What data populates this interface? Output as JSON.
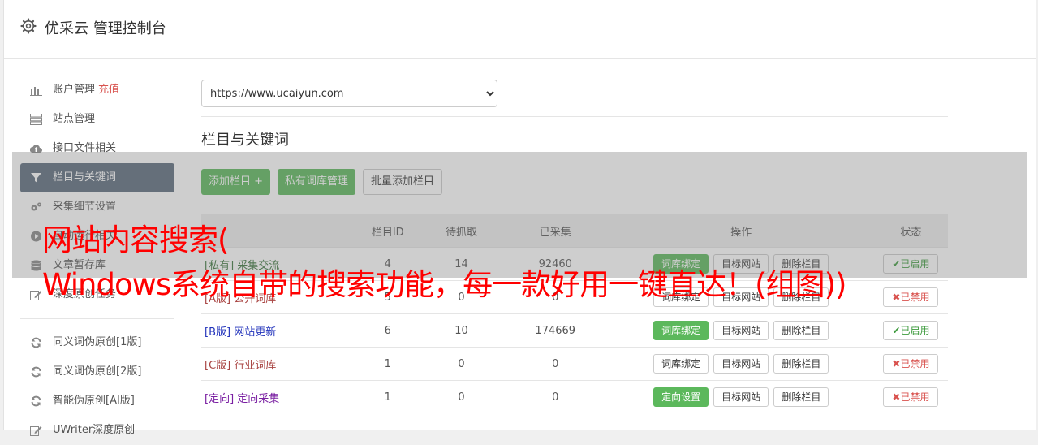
{
  "header": {
    "title": "优采云 管理控制台",
    "icon": "gear-icon"
  },
  "sidebar": {
    "items": [
      {
        "label": "账户管理",
        "extra": "充值",
        "icon": "bar-chart-icon"
      },
      {
        "label": "站点管理",
        "icon": "server-icon"
      },
      {
        "label": "接口文件相关",
        "icon": "cloud-upload-icon"
      },
      {
        "label": "栏目与关键词",
        "icon": "filter-icon",
        "active": true
      },
      {
        "label": "采集细节设置",
        "icon": "cogs-icon"
      },
      {
        "label": "自动运行相关",
        "icon": "play-circle-icon"
      },
      {
        "label": "文章暂存库",
        "icon": "database-icon"
      },
      {
        "label": "深度原创任务",
        "icon": "edit-icon"
      }
    ],
    "items2": [
      {
        "label": "同义词伪原创[1版]",
        "icon": "refresh-icon"
      },
      {
        "label": "同义词伪原创[2版]",
        "icon": "refresh-icon"
      },
      {
        "label": "智能伪原创[AI版]",
        "icon": "refresh-icon"
      },
      {
        "label": "UWriter深度原创",
        "icon": "edit-icon"
      }
    ]
  },
  "main": {
    "site_select": "https://www.ucaiyun.com",
    "section_title": "栏目与关键词",
    "buttons": {
      "add": "添加栏目 +",
      "private_lib": "私有词库管理",
      "batch_add": "批量添加栏目"
    },
    "table": {
      "headers": [
        "",
        "栏目ID",
        "待抓取",
        "已采集",
        "操作",
        "状态"
      ],
      "rows": [
        {
          "tag": "[私有]",
          "name": "采集交流",
          "id": "4",
          "pending": "14",
          "collected": "92460",
          "op1": "词库绑定",
          "op2": "目标网站",
          "op3": "删除栏目",
          "status": "已启用",
          "tag_class": "kw-green"
        },
        {
          "tag": "[A版]",
          "name": "公开词库",
          "id": "5",
          "pending": "0",
          "collected": "0",
          "op1": "词库绑定",
          "op2": "目标网站",
          "op3": "删除栏目",
          "status": "已禁用",
          "tag_class": "kw-red"
        },
        {
          "tag": "[B版]",
          "name": "网站更新",
          "id": "6",
          "pending": "10",
          "collected": "174669",
          "op1": "词库绑定",
          "op2": "目标网站",
          "op3": "删除栏目",
          "status": "已启用",
          "tag_class": "kw-blue"
        },
        {
          "tag": "[C版]",
          "name": "行业词库",
          "id": "1",
          "pending": "0",
          "collected": "0",
          "op1": "词库绑定",
          "op2": "目标网站",
          "op3": "删除栏目",
          "status": "已禁用",
          "tag_class": "kw-red"
        },
        {
          "tag": "[定向]",
          "name": "定向采集",
          "id": "1",
          "pending": "0",
          "collected": "0",
          "op1": "定向设置",
          "op2": "目标网站",
          "op3": "删除栏目",
          "status": "已禁用",
          "tag_class": "kw-purple"
        }
      ]
    }
  },
  "banner": {
    "line1": "网站内容搜索(",
    "line2": "Windows系统自带的搜索功能，每一款好用一键直达！(组图))"
  },
  "colors": {
    "accent_green": "#5cb85c",
    "active_nav": "#5b6b7c",
    "banner_red": "#ff0000"
  }
}
